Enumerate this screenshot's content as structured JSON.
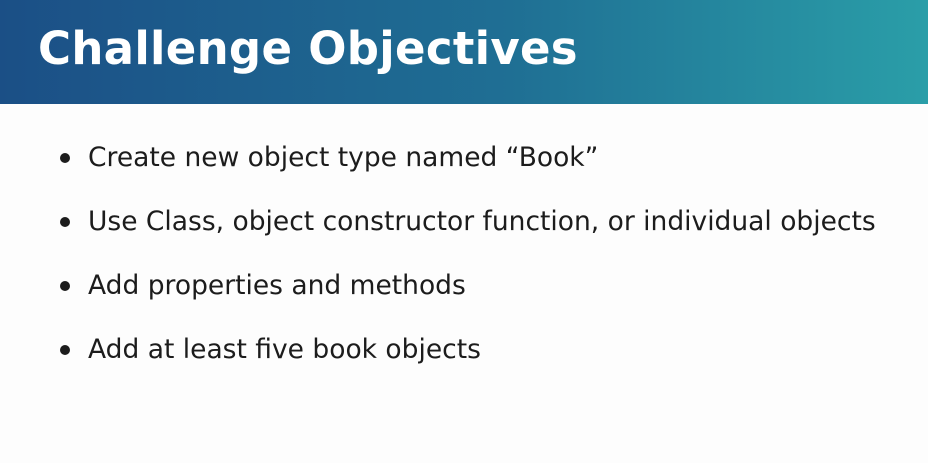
{
  "slide": {
    "title": "Challenge Objectives",
    "bullets": [
      {
        "text": "Create new object type named “Book”"
      },
      {
        "text": "Use Class, object constructor function, or individual objects"
      },
      {
        "text": "Add properties and methods"
      },
      {
        "text": "Add at least five book objects"
      }
    ]
  },
  "colors": {
    "title_gradient_start": "#1b4f86",
    "title_gradient_end": "#2a9ea8",
    "title_text": "#ffffff",
    "body_text": "#1c1c1c",
    "background": "#fdfdfd"
  }
}
